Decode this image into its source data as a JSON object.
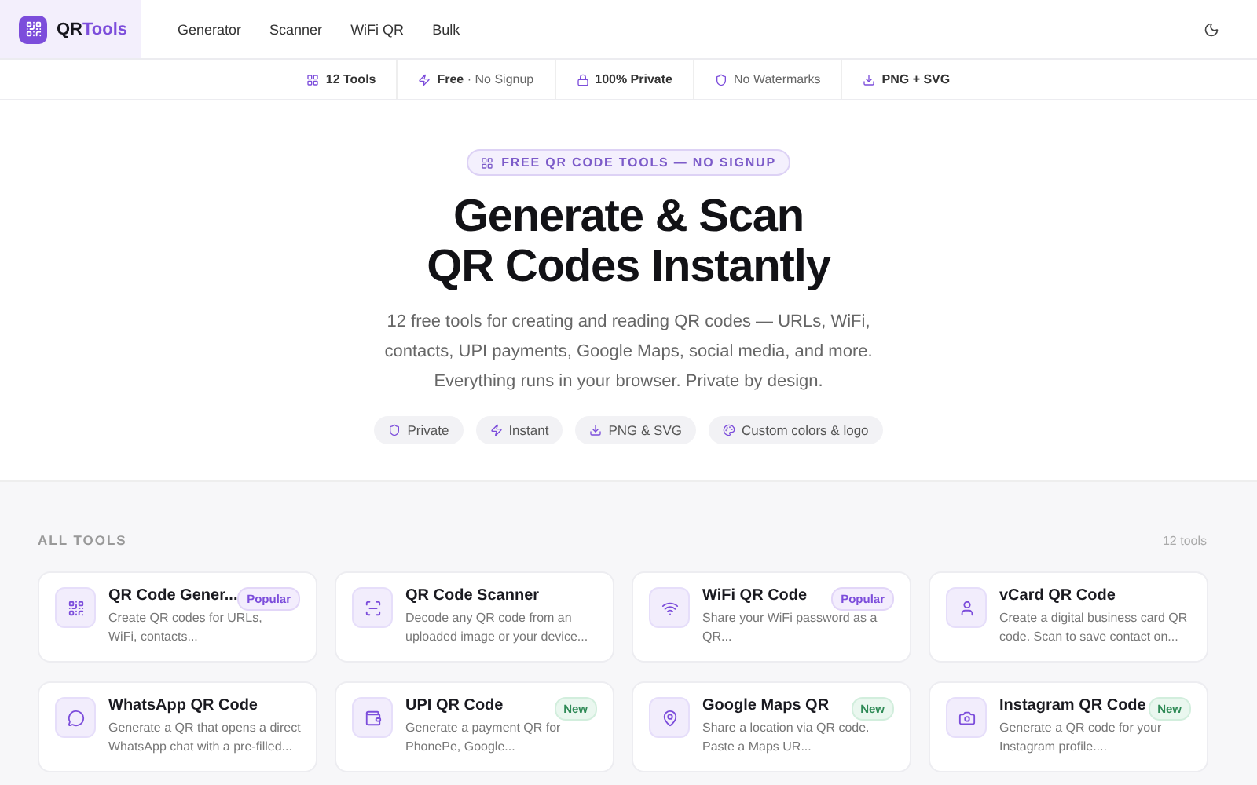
{
  "brand": {
    "first": "QR",
    "second": "Tools"
  },
  "nav": [
    {
      "label": "Generator"
    },
    {
      "label": "Scanner"
    },
    {
      "label": "WiFi QR"
    },
    {
      "label": "Bulk"
    }
  ],
  "features": [
    {
      "kind": "grid",
      "bold": "12 Tools"
    },
    {
      "kind": "bolt",
      "bold": "Free",
      "rest": "· No Signup"
    },
    {
      "kind": "lock",
      "bold": "100% Private"
    },
    {
      "kind": "shield",
      "rest": "No Watermarks"
    },
    {
      "kind": "download",
      "bold": "PNG + SVG"
    }
  ],
  "hero": {
    "eyebrow": "FREE QR CODE TOOLS — NO SIGNUP",
    "title_line1": "Generate & Scan",
    "title_line2": "QR Codes Instantly",
    "subtitle": "12 free tools for creating and reading QR codes — URLs, WiFi, contacts, UPI payments, Google Maps, social media, and more. Everything runs in your browser. Private by design.",
    "chips": [
      {
        "kind": "shield",
        "label": "Private"
      },
      {
        "kind": "bolt",
        "label": "Instant"
      },
      {
        "kind": "download",
        "label": "PNG & SVG"
      },
      {
        "kind": "palette",
        "label": "Custom colors & logo"
      }
    ]
  },
  "tools_section": {
    "heading": "ALL TOOLS",
    "count": "12 tools"
  },
  "tools": [
    {
      "kind": "qr",
      "title": "QR Code Gener...",
      "desc": "Create QR codes for URLs, WiFi, contacts...",
      "badge": {
        "kind": "popular",
        "label": "Popular"
      }
    },
    {
      "kind": "scan",
      "title": "QR Code Scanner",
      "desc": "Decode any QR code from an uploaded image or your device..."
    },
    {
      "kind": "wifi",
      "title": "WiFi QR Code",
      "desc": "Share your WiFi password as a QR...",
      "badge": {
        "kind": "popular",
        "label": "Popular"
      }
    },
    {
      "kind": "user",
      "title": "vCard QR Code",
      "desc": "Create a digital business card QR code. Scan to save contact on..."
    },
    {
      "kind": "chat",
      "title": "WhatsApp QR Code",
      "desc": "Generate a QR that opens a direct WhatsApp chat with a pre-filled..."
    },
    {
      "kind": "wallet",
      "title": "UPI QR Code",
      "desc": "Generate a payment QR for PhonePe, Google...",
      "badge": {
        "kind": "new",
        "label": "New"
      }
    },
    {
      "kind": "pin",
      "title": "Google Maps QR",
      "desc": "Share a location via QR code. Paste a Maps UR...",
      "badge": {
        "kind": "new",
        "label": "New"
      }
    },
    {
      "kind": "camera",
      "title": "Instagram QR Code",
      "desc": "Generate a QR code for your Instagram profile....",
      "badge": {
        "kind": "new",
        "label": "New"
      }
    }
  ]
}
